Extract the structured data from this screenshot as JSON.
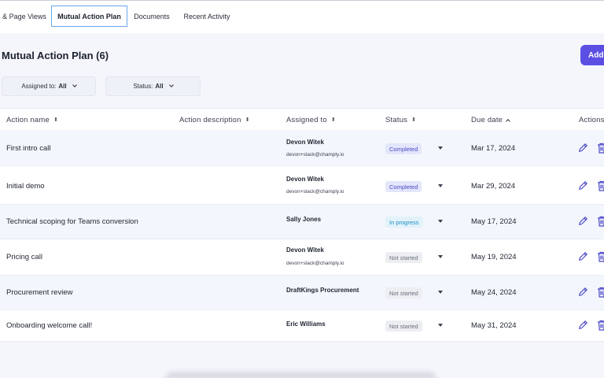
{
  "tabs": [
    {
      "label": "& Page Views",
      "active": false
    },
    {
      "label": "Mutual Action Plan",
      "active": true
    },
    {
      "label": "Documents",
      "active": false
    },
    {
      "label": "Recent Activity",
      "active": false
    }
  ],
  "header": {
    "title": "Mutual Action Plan (6)",
    "add_label": "Add"
  },
  "filters": {
    "assigned_label": "Assigned to:",
    "assigned_value": "All",
    "status_label": "Status:",
    "status_value": "All"
  },
  "columns": {
    "action_name": "Action name",
    "action_description": "Action description",
    "assigned_to": "Assigned to",
    "status": "Status",
    "due_date": "Due date",
    "actions": "Actions"
  },
  "rows": [
    {
      "name": "First intro call",
      "assignee": "Devon Witek",
      "email": "devon+slack@champly.io",
      "status": "Completed",
      "status_key": "completed",
      "due": "Mar 17, 2024"
    },
    {
      "name": "Initial demo",
      "assignee": "Devon Witek",
      "email": "devon+slack@champly.io",
      "status": "Completed",
      "status_key": "completed",
      "due": "Mar 29, 2024"
    },
    {
      "name": "Technical scoping for Teams conversion",
      "assignee": "Sally Jones",
      "email": "",
      "status": "In progress",
      "status_key": "inprogress",
      "due": "May 17, 2024"
    },
    {
      "name": "Pricing call",
      "assignee": "Devon Witek",
      "email": "devon+slack@champly.io",
      "status": "Not started",
      "status_key": "notstarted",
      "due": "May 19, 2024"
    },
    {
      "name": "Procurement review",
      "assignee": "DraftKings Procurement",
      "email": "",
      "status": "Not started",
      "status_key": "notstarted",
      "due": "May 24, 2024"
    },
    {
      "name": "Onboarding welcome call!",
      "assignee": "Eric Williams",
      "email": "",
      "status": "Not started",
      "status_key": "notstarted",
      "due": "May 31, 2024"
    }
  ],
  "colors": {
    "accent": "#5b4fe3",
    "completed": "#4a48c8",
    "in_progress": "#1d8fc4",
    "not_started": "#6a6f7c"
  },
  "icons": {
    "edit": "pencil-icon",
    "delete": "trash-icon",
    "sort": "sort-icon",
    "dropdown": "chevron-down-icon"
  }
}
